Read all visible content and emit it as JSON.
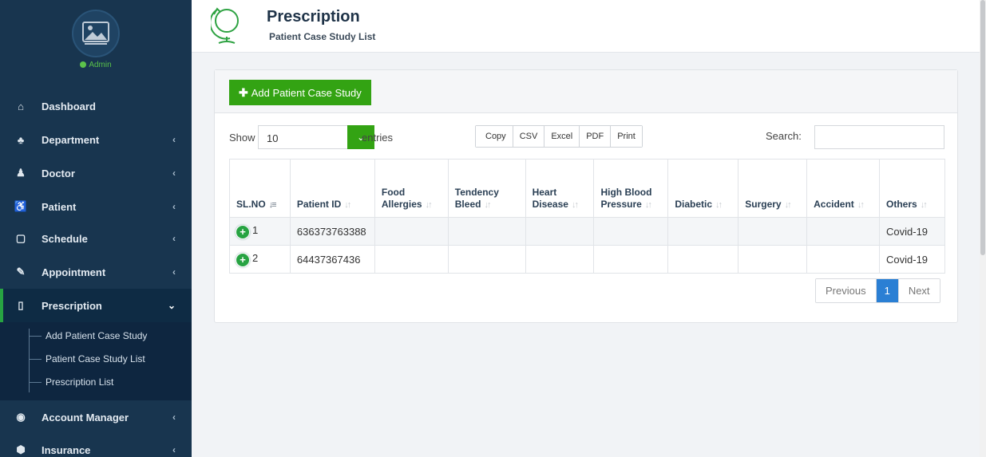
{
  "sidebar": {
    "user_status": "Admin",
    "nav": [
      {
        "label": "Dashboard",
        "icon": "home-icon",
        "glyph": "⌂",
        "has_chevron": false
      },
      {
        "label": "Department",
        "icon": "sitemap-icon",
        "glyph": "♣",
        "has_chevron": true
      },
      {
        "label": "Doctor",
        "icon": "user-md-icon",
        "glyph": "♟",
        "has_chevron": true
      },
      {
        "label": "Patient",
        "icon": "wheelchair-icon",
        "glyph": "♿",
        "has_chevron": true
      },
      {
        "label": "Schedule",
        "icon": "calendar-icon",
        "glyph": "▢",
        "has_chevron": true
      },
      {
        "label": "Appointment",
        "icon": "edit-icon",
        "glyph": "✎",
        "has_chevron": true
      },
      {
        "label": "Prescription",
        "icon": "book-icon",
        "glyph": "▯",
        "has_chevron": true,
        "active": true
      },
      {
        "label": "Account Manager",
        "icon": "money-icon",
        "glyph": "◉",
        "has_chevron": true
      },
      {
        "label": "Insurance",
        "icon": "shield-icon",
        "glyph": "⬢",
        "has_chevron": true
      }
    ],
    "submenu": [
      "Add Patient Case Study",
      "Patient Case Study List",
      "Prescription List"
    ]
  },
  "header": {
    "title": "Prescription",
    "subtitle": "Patient Case Study List"
  },
  "toolbar": {
    "add_label": "Add Patient Case Study"
  },
  "controls": {
    "show_label": "Show",
    "entries_value": "10",
    "entries_label": "entries",
    "export_buttons": [
      "Copy",
      "CSV",
      "Excel",
      "PDF",
      "Print"
    ],
    "search_label": "Search:",
    "search_value": ""
  },
  "table": {
    "columns": [
      "SL.NO",
      "Patient ID",
      "Food Allergies",
      "Tendency Bleed",
      "Heart Disease",
      "High Blood Pressure",
      "Diabetic",
      "Surgery",
      "Accident",
      "Others"
    ],
    "rows": [
      [
        "1",
        "636373763388",
        "",
        "",
        "",
        "",
        "",
        "",
        "",
        "Covid-19"
      ],
      [
        "2",
        "64437367436",
        "",
        "",
        "",
        "",
        "",
        "",
        "",
        "Covid-19"
      ]
    ]
  },
  "pagination": {
    "previous": "Previous",
    "current": "1",
    "next": "Next"
  },
  "colors": {
    "sidebar_bg": "#18354f",
    "accent_green": "#33a313",
    "active_page_blue": "#2a7fd4"
  }
}
